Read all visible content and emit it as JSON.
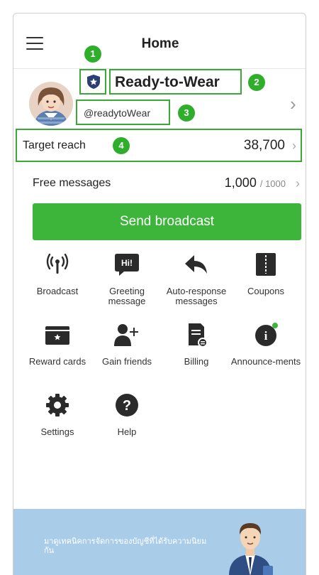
{
  "header": {
    "title": "Home",
    "menu_icon": "hamburger-icon"
  },
  "profile": {
    "badge_icon": "verified-shield-icon",
    "name": "Ready-to-Wear",
    "handle": "@readytoWear"
  },
  "steps": [
    "1",
    "2",
    "3",
    "4"
  ],
  "stats": {
    "target_reach_label": "Target reach",
    "target_reach_value": "38,700",
    "free_messages_label": "Free messages",
    "free_messages_value": "1,000",
    "free_messages_limit": "/ 1000"
  },
  "send_broadcast_label": "Send broadcast",
  "features": [
    {
      "label": "Broadcast",
      "icon": "broadcast-icon"
    },
    {
      "label": "Greeting message",
      "icon": "greeting-message-icon",
      "icon_text": "Hi!"
    },
    {
      "label": "Auto-response messages",
      "icon": "auto-response-icon"
    },
    {
      "label": "Coupons",
      "icon": "coupon-icon"
    },
    {
      "label": "Reward cards",
      "icon": "reward-card-icon"
    },
    {
      "label": "Gain friends",
      "icon": "add-friend-icon"
    },
    {
      "label": "Billing",
      "icon": "billing-icon"
    },
    {
      "label": "Announce-ments",
      "icon": "announcement-icon",
      "icon_text": "i"
    },
    {
      "label": "Settings",
      "icon": "gear-icon"
    },
    {
      "label": "Help",
      "icon": "help-icon",
      "icon_text": "?"
    }
  ],
  "banner": {
    "text": "มาดูเทคนิคการจัดการของบัญชีที่ได้รับความนิยมกัน"
  },
  "colors": {
    "accent_green": "#3db53a",
    "annotation_green": "#2fae2b",
    "banner_blue": "#a9cde9",
    "icon_dark": "#2b2b2b"
  }
}
